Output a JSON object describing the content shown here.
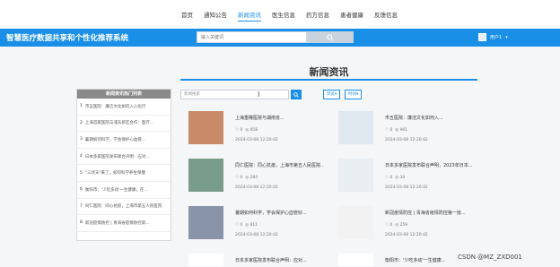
{
  "nav": {
    "items": [
      "首页",
      "通知公告",
      "新闻资讯",
      "医生信息",
      "药方信息",
      "患者健康",
      "反馈信息"
    ],
    "active_index": 2
  },
  "banner": {
    "title": "智慧医疗数据共享和个性化推荐系统",
    "search_placeholder": "输入关键词",
    "user_label": "用户1"
  },
  "page": {
    "heading": "新闻资讯"
  },
  "hot": {
    "header": "新闻资讯热门列表",
    "items": [
      {
        "num": "1",
        "text": "市五医院：廉洁文化如何入心化行"
      },
      {
        "num": "2",
        "text": "上海首家医院与浦东新区合作：医疗..."
      },
      {
        "num": "3",
        "text": "暑期如何科学，学会保护心血管..."
      },
      {
        "num": "4",
        "text": "日本多家医院发布联合声明：应对..."
      },
      {
        "num": "5",
        "text": "\"三伏天\"来了，如何科学养生保健"
      },
      {
        "num": "6",
        "text": "衡阳市：'少吃多动'一生健康，在..."
      },
      {
        "num": "7",
        "text": "同仁医院：同心抗疫，上海市第五人民医院"
      },
      {
        "num": "8",
        "text": "新冠疫情防控 | 青海省疫情防控第..."
      }
    ]
  },
  "filter": {
    "search_placeholder": "新闻搜索",
    "sort1": "浏览▾",
    "sort2": "时间▾"
  },
  "news": [
    {
      "title": "上海重瞳医院与湖南省...",
      "likes": "0",
      "views": "958",
      "date": "2024-03-08 12:20:42",
      "color": "#c98a6a"
    },
    {
      "title": "市五医院：廉洁文化如何入...",
      "likes": "0",
      "views": "961",
      "date": "2024-03-08 12:20:42",
      "color": "#dfe7ef"
    },
    {
      "title": "同仁医院：同心抗疫，上海市第五人民医院...",
      "likes": "0",
      "views": "284",
      "date": "2024-03-08 12:20:42",
      "color": "#7a9c8a"
    },
    {
      "title": "日本多家医院发布联合声明，2023年日本...",
      "likes": "0",
      "views": "34",
      "date": "2024-03-08 12:20:42",
      "color": "#e9eef3"
    },
    {
      "title": "暑期如何科学，学会保护心血管好...",
      "likes": "0",
      "views": "811",
      "date": "2024-03-08 12:20:42",
      "color": "#8a94a8"
    },
    {
      "title": "新冠疫情防控 | 青海省疫情防控第一批...",
      "likes": "0",
      "views": "259",
      "date": "2024-03-08 12:20:42",
      "color": "#f2f2f2"
    },
    {
      "title": "日本多家医院发布联合声明：应对...",
      "likes": "",
      "views": "",
      "date": "",
      "color": "#ffffff"
    },
    {
      "title": "衡阳市：'少吃多动'一生健康...",
      "likes": "",
      "views": "",
      "date": "",
      "color": "#ffffff"
    }
  ],
  "watermark": "CSDN @MZ_ZXD001"
}
